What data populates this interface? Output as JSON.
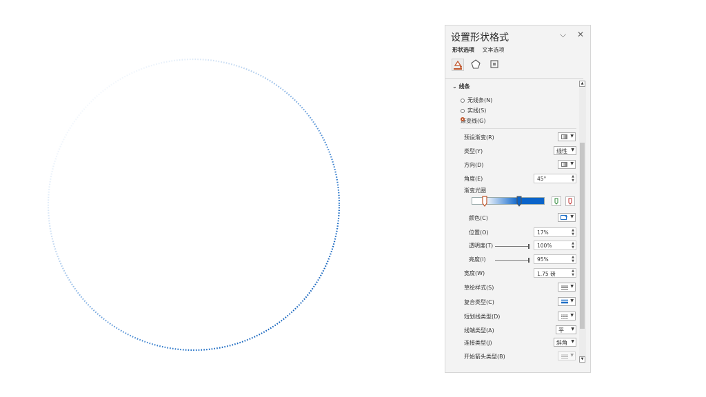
{
  "panel": {
    "title": "设置形状格式",
    "collapse_icon": "chevron-down-icon",
    "close_icon": "close-icon",
    "tabs": [
      "形状选项",
      "文本选项"
    ],
    "categories": [
      "fill-line-icon",
      "effects-pentagon-icon",
      "size-properties-icon"
    ]
  },
  "line": {
    "section_label": "线条",
    "options": [
      "无线条(N)",
      "实线(S)",
      "渐变线(G)"
    ],
    "selected": "渐变线(G)",
    "preset_label": "预设渐变(R)",
    "type_label": "类型(Y)",
    "type_value": "线性",
    "direction_label": "方向(D)",
    "angle_label": "角度(E)",
    "angle_value": "45°",
    "stops_label": "渐变光圈",
    "color_label": "颜色(C)",
    "position_label": "位置(O)",
    "position_value": "17%",
    "transparency_label": "透明度(T)",
    "transparency_value": "100%",
    "transparency_level": 1.0,
    "brightness_label": "亮度(I)",
    "brightness_value": "95%",
    "brightness_level": 0.95,
    "width_label": "宽度(W)",
    "width_value": "1.75 磅",
    "sketch_label": "草绘样式(S)",
    "compound_label": "复合类型(C)",
    "dash_label": "短划线类型(D)",
    "cap_label": "线端类型(A)",
    "cap_value": "平",
    "join_label": "连接类型(J)",
    "join_value": "斜角",
    "arrow_label": "开始箭头类型(B)"
  },
  "colors": {
    "accent": "#c0552a",
    "gradient_end": "#0a63c9",
    "circle_dots": "#1f6fc6"
  }
}
